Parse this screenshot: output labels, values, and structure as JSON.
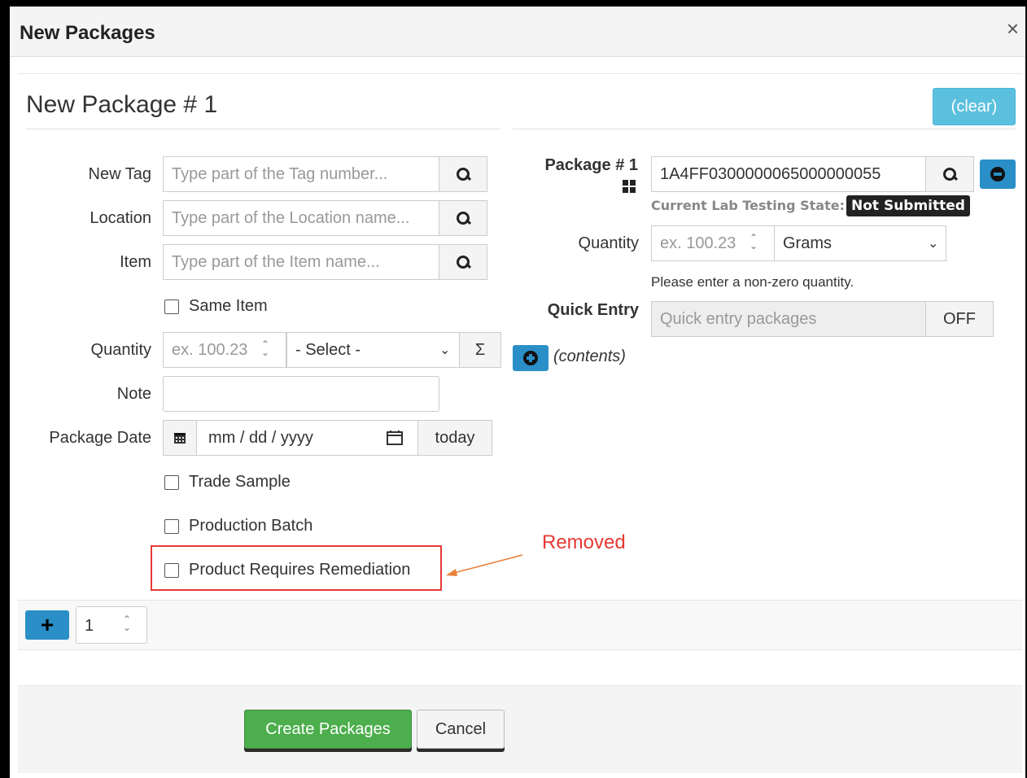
{
  "dialog": {
    "title": "New Packages",
    "close_glyph": "×"
  },
  "package": {
    "heading": "New Package # 1",
    "clear_label": "(clear)"
  },
  "left_form": {
    "new_tag": {
      "label": "New Tag",
      "placeholder": "Type part of the Tag number..."
    },
    "location": {
      "label": "Location",
      "placeholder": "Type part of the Location name..."
    },
    "item": {
      "label": "Item",
      "placeholder": "Type part of the Item name..."
    },
    "same_item_label": "Same Item",
    "quantity": {
      "label": "Quantity",
      "placeholder": "ex. 100.23",
      "unit_value": "- Select -",
      "sum_glyph": "Σ"
    },
    "note": {
      "label": "Note",
      "value": ""
    },
    "package_date": {
      "label": "Package Date",
      "placeholder": "mm / dd / yyyy",
      "today_label": "today"
    },
    "trade_sample_label": "Trade Sample",
    "production_batch_label": "Production Batch",
    "remediation_label": "Product Requires Remediation"
  },
  "right_form": {
    "package_label": "Package # 1",
    "package_value": "1A4FF0300000065000000055",
    "lab_state_label": "Current Lab Testing State:",
    "lab_state_value": "Not Submitted",
    "quantity": {
      "label": "Quantity",
      "placeholder": "ex. 100.23",
      "unit_value": "Grams"
    },
    "quantity_hint": "Please enter a non-zero quantity.",
    "quick_entry": {
      "label": "Quick Entry",
      "placeholder": "Quick entry packages",
      "toggle_label": "OFF"
    },
    "contents_label": "(contents)"
  },
  "annotation": {
    "removed_text": "Removed",
    "color": "#e53935",
    "arrow_color": "#e8803a"
  },
  "footer": {
    "add_glyph": "+",
    "count_value": "1",
    "create_label": "Create Packages",
    "cancel_label": "Cancel"
  },
  "colors": {
    "info": "#5bc0de",
    "primary": "#2a8fc7",
    "success": "#4cae4c"
  }
}
